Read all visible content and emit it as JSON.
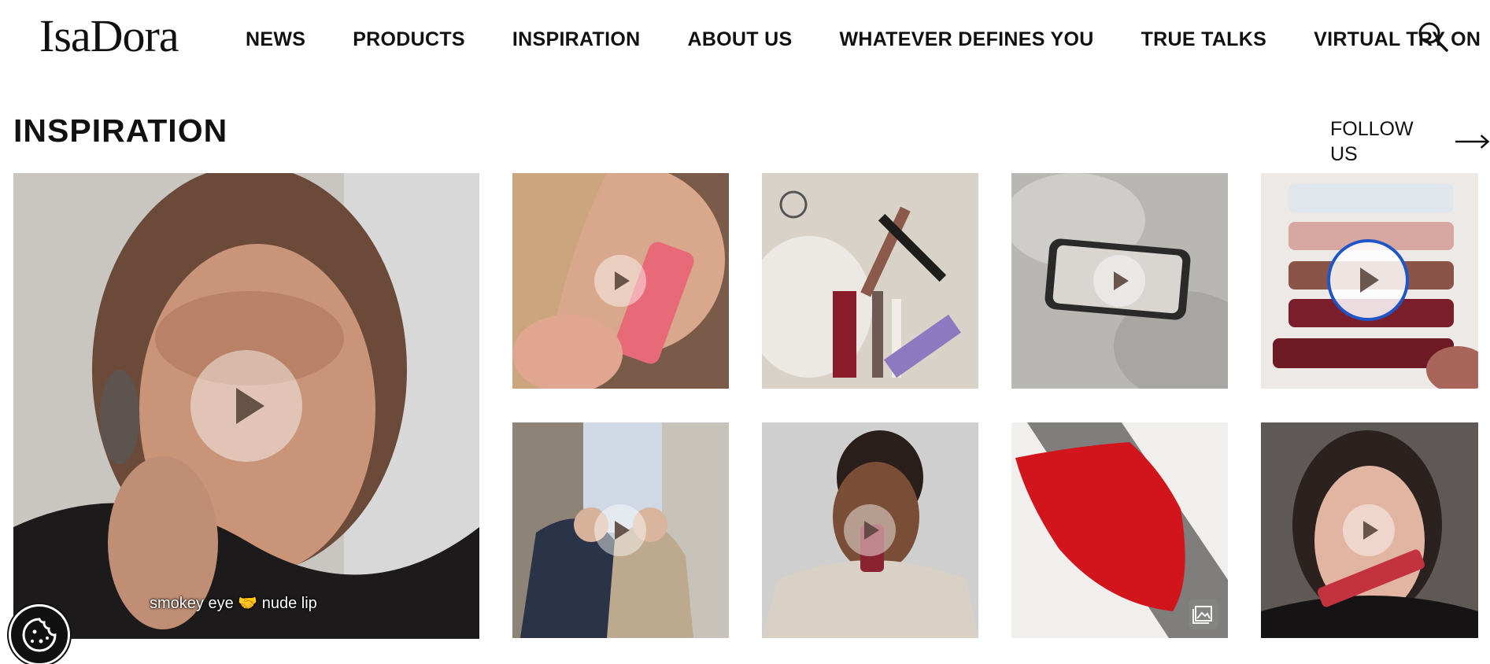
{
  "brand": {
    "logo_text": "IsaDora"
  },
  "nav": {
    "items": [
      {
        "label": "NEWS"
      },
      {
        "label": "PRODUCTS"
      },
      {
        "label": "INSPIRATION"
      },
      {
        "label": "ABOUT US"
      },
      {
        "label": "WHATEVER DEFINES YOU"
      },
      {
        "label": "TRUE TALKS"
      },
      {
        "label": "VIRTUAL TRY ON"
      }
    ],
    "search_icon": "search-icon"
  },
  "section": {
    "title": "INSPIRATION",
    "follow_label": "FOLLOW US",
    "follow_icon": "arrow-right-icon"
  },
  "tiles": [
    {
      "kind": "video",
      "caption": "smokey eye 🤝 nude lip"
    },
    {
      "kind": "video"
    },
    {
      "kind": "image"
    },
    {
      "kind": "video"
    },
    {
      "kind": "video",
      "focused": true
    },
    {
      "kind": "video"
    },
    {
      "kind": "video"
    },
    {
      "kind": "image",
      "icon": "gallery-icon"
    },
    {
      "kind": "video"
    }
  ],
  "cookie": {
    "icon": "cookie-icon"
  },
  "colors": {
    "text": "#111111",
    "focus_ring": "#1e56c8",
    "background": "#ffffff"
  }
}
